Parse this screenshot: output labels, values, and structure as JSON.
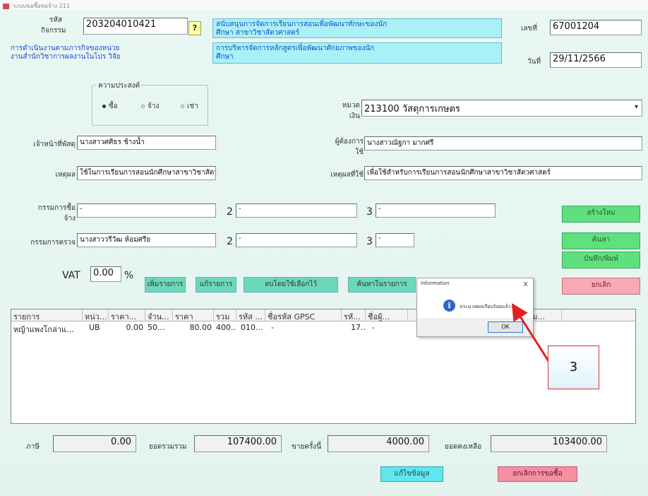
{
  "window": {
    "title": "ระบบขอซื้อขอจ้าง 211"
  },
  "header": {
    "code_label_1": "รหัส",
    "code_label_2": "กิจกรรม",
    "code_value": "203204010421",
    "q_button": "?",
    "activity_name_1": "สนับสนุนการจัดการเรียนการสอนเพื่อพัฒนาทักษะของนัก",
    "activity_name_2": "ศึกษา สาขาวิชาสัตวศาสตร์",
    "strategy_1": "การดำเนินงานตามภารกิจของหน่วย",
    "strategy_2": "งานสำนักวิชาการผลงานในโปร วิจัย",
    "plan_1": "การบริหารจัดการหลักสูตรเพื่อพัฒนาศักยภาพของนัก",
    "plan_2": "ศึกษา",
    "doc_no_label": "เลขที่",
    "doc_no_value": "67001204",
    "date_label": "วันที่",
    "date_value": "29/11/2566"
  },
  "purpose": {
    "title": "ความประสงค์",
    "options": [
      "ซื้อ",
      "จ้าง",
      "เช่า"
    ],
    "selected": "ซื้อ"
  },
  "fields": {
    "budget_label_1": "หมวด",
    "budget_label_2": "เงิน",
    "budget_value": "213100 วัสดุการเกษตร",
    "owner_label": "เจ้าหน้าที่พัสดุ",
    "owner_value": "นางสาวศศิธร ช้างน้ำ",
    "requester_label_1": "ผู้ต้องการ",
    "requester_label_2": "ใช้",
    "requester_value": "นางสาวณัฐกา มากศรี",
    "reason_label": "เหตุผล",
    "reason_value": "ใช้ในการเรียนการสอนนักศึกษาสาขาวิชาสัตวศาสตร์",
    "reason2_label": "เหตุผลที่ใช้",
    "reason2_value": "เพื่อใช้สำหรับการเรียนการสอนนักศึกษาสาขาวิชาสัตวศาสตร์",
    "committee_buy_label_1": "กรรมการซื้อ",
    "committee_buy_label_2": "จ้าง",
    "committee_buy_1": "-",
    "committee_buy_2": "-",
    "committee_buy_3": "-",
    "committee_check_label": "กรรมการตรวจ",
    "committee_check_1": "นางสาววรีวัฒ ห้อมศรีย",
    "committee_check_2": "-",
    "committee_check_3": "-",
    "num2": "2",
    "num3": "3",
    "vat_label": "VAT",
    "vat_value": "0.00",
    "vat_unit": "%"
  },
  "action_buttons": {
    "add_item": "เพิ่มรายการ",
    "edit_item": "แก้รายการ",
    "delete_item": "ลบโดยใช้เลือกไว้",
    "search_item": "ค้นหาในรายการ"
  },
  "side_buttons": {
    "new": "สร้างใหม่",
    "search": "ค้นหา",
    "save_print": "บันทึก/พิมพ์",
    "cancel": "ยกเลิก"
  },
  "table": {
    "columns": [
      "รายการ",
      "หน่ว...",
      "ราคา...",
      "จำน...",
      "ราคา",
      "รวม",
      "รหัส ...",
      "ชื่อรหัส GPSC",
      "รหั...",
      "ชื่อผู้...",
      "",
      "หม..."
    ],
    "rows": [
      [
        "หญ้าแพงโกล่าแ...",
        "UB",
        "0.00",
        "50...",
        "80.00",
        "400...",
        "010...",
        "-",
        "17...",
        "-",
        "",
        "-"
      ]
    ]
  },
  "totals": {
    "tax_label": "ภาษี",
    "tax_value": "0.00",
    "total_label": "ยอดรวมรวม",
    "total_value": "107400.00",
    "received_label": "ขายครั้งนี้",
    "received_value": "4000.00",
    "remaining_label": "ยอดคงเหลือ",
    "remaining_value": "103400.00"
  },
  "bottom_buttons": {
    "edit_data": "แก้ไขข้อมูล",
    "cancel_request": "ยกเลิกการขอซื้อ"
  },
  "dialog": {
    "title": "Information",
    "close": "x",
    "icon": "i",
    "message": "ประมวลผลเรียบร้อยแล้ว",
    "ok": "OK"
  },
  "annotation": {
    "callout_text": "3",
    "arrow_color": "#e02020"
  }
}
